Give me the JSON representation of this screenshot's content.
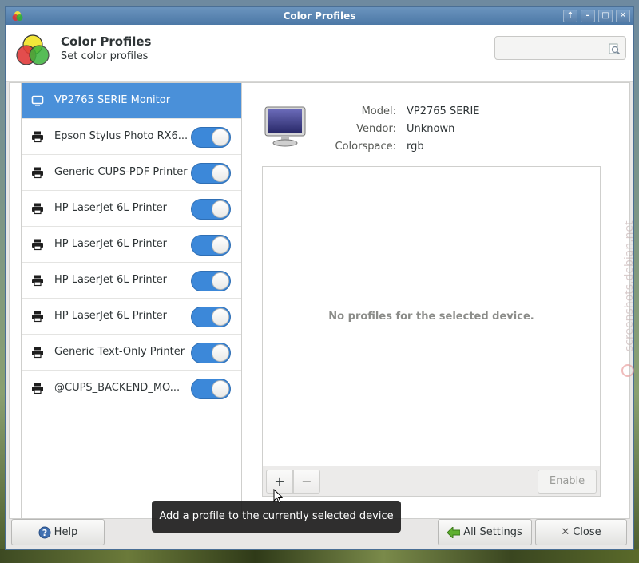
{
  "window": {
    "title": "Color Profiles",
    "wm_buttons": [
      "↑",
      "–",
      "□",
      "✕"
    ]
  },
  "header": {
    "title": "Color Profiles",
    "subtitle": "Set color profiles",
    "search_value": ""
  },
  "devices": [
    {
      "label": "VP2765 SERIE Monitor",
      "icon": "monitor-icon",
      "selected": true,
      "toggle": null
    },
    {
      "label": "Epson Stylus Photo RX6...",
      "icon": "printer-icon",
      "selected": false,
      "toggle": true
    },
    {
      "label": "Generic CUPS-PDF Printer",
      "icon": "printer-icon",
      "selected": false,
      "toggle": true
    },
    {
      "label": "HP LaserJet 6L Printer",
      "icon": "printer-icon",
      "selected": false,
      "toggle": true
    },
    {
      "label": "HP LaserJet 6L Printer",
      "icon": "printer-icon",
      "selected": false,
      "toggle": true
    },
    {
      "label": "HP LaserJet 6L Printer",
      "icon": "printer-icon",
      "selected": false,
      "toggle": true
    },
    {
      "label": "HP LaserJet 6L Printer",
      "icon": "printer-icon",
      "selected": false,
      "toggle": true
    },
    {
      "label": "Generic Text-Only Printer",
      "icon": "printer-icon",
      "selected": false,
      "toggle": true
    },
    {
      "label": "@CUPS_BACKEND_MO...",
      "icon": "printer-icon",
      "selected": false,
      "toggle": true
    }
  ],
  "details": {
    "model_label": "Model:",
    "model_value": "VP2765 SERIE",
    "vendor_label": "Vendor:",
    "vendor_value": "Unknown",
    "colorspace_label": "Colorspace:",
    "colorspace_value": "rgb",
    "empty_message": "No profiles for the selected device.",
    "add_label": "+",
    "remove_label": "−",
    "enable_label": "Enable"
  },
  "buttons": {
    "help": "Help",
    "all_settings": "All Settings",
    "close": "Close"
  },
  "tooltip": "Add a profile to the currently selected device",
  "watermark": "screenshots.debian.net",
  "colors": {
    "selection": "#4a90d9",
    "toggle_on": "#3c88d9",
    "titlebar": "#4c78a6"
  }
}
